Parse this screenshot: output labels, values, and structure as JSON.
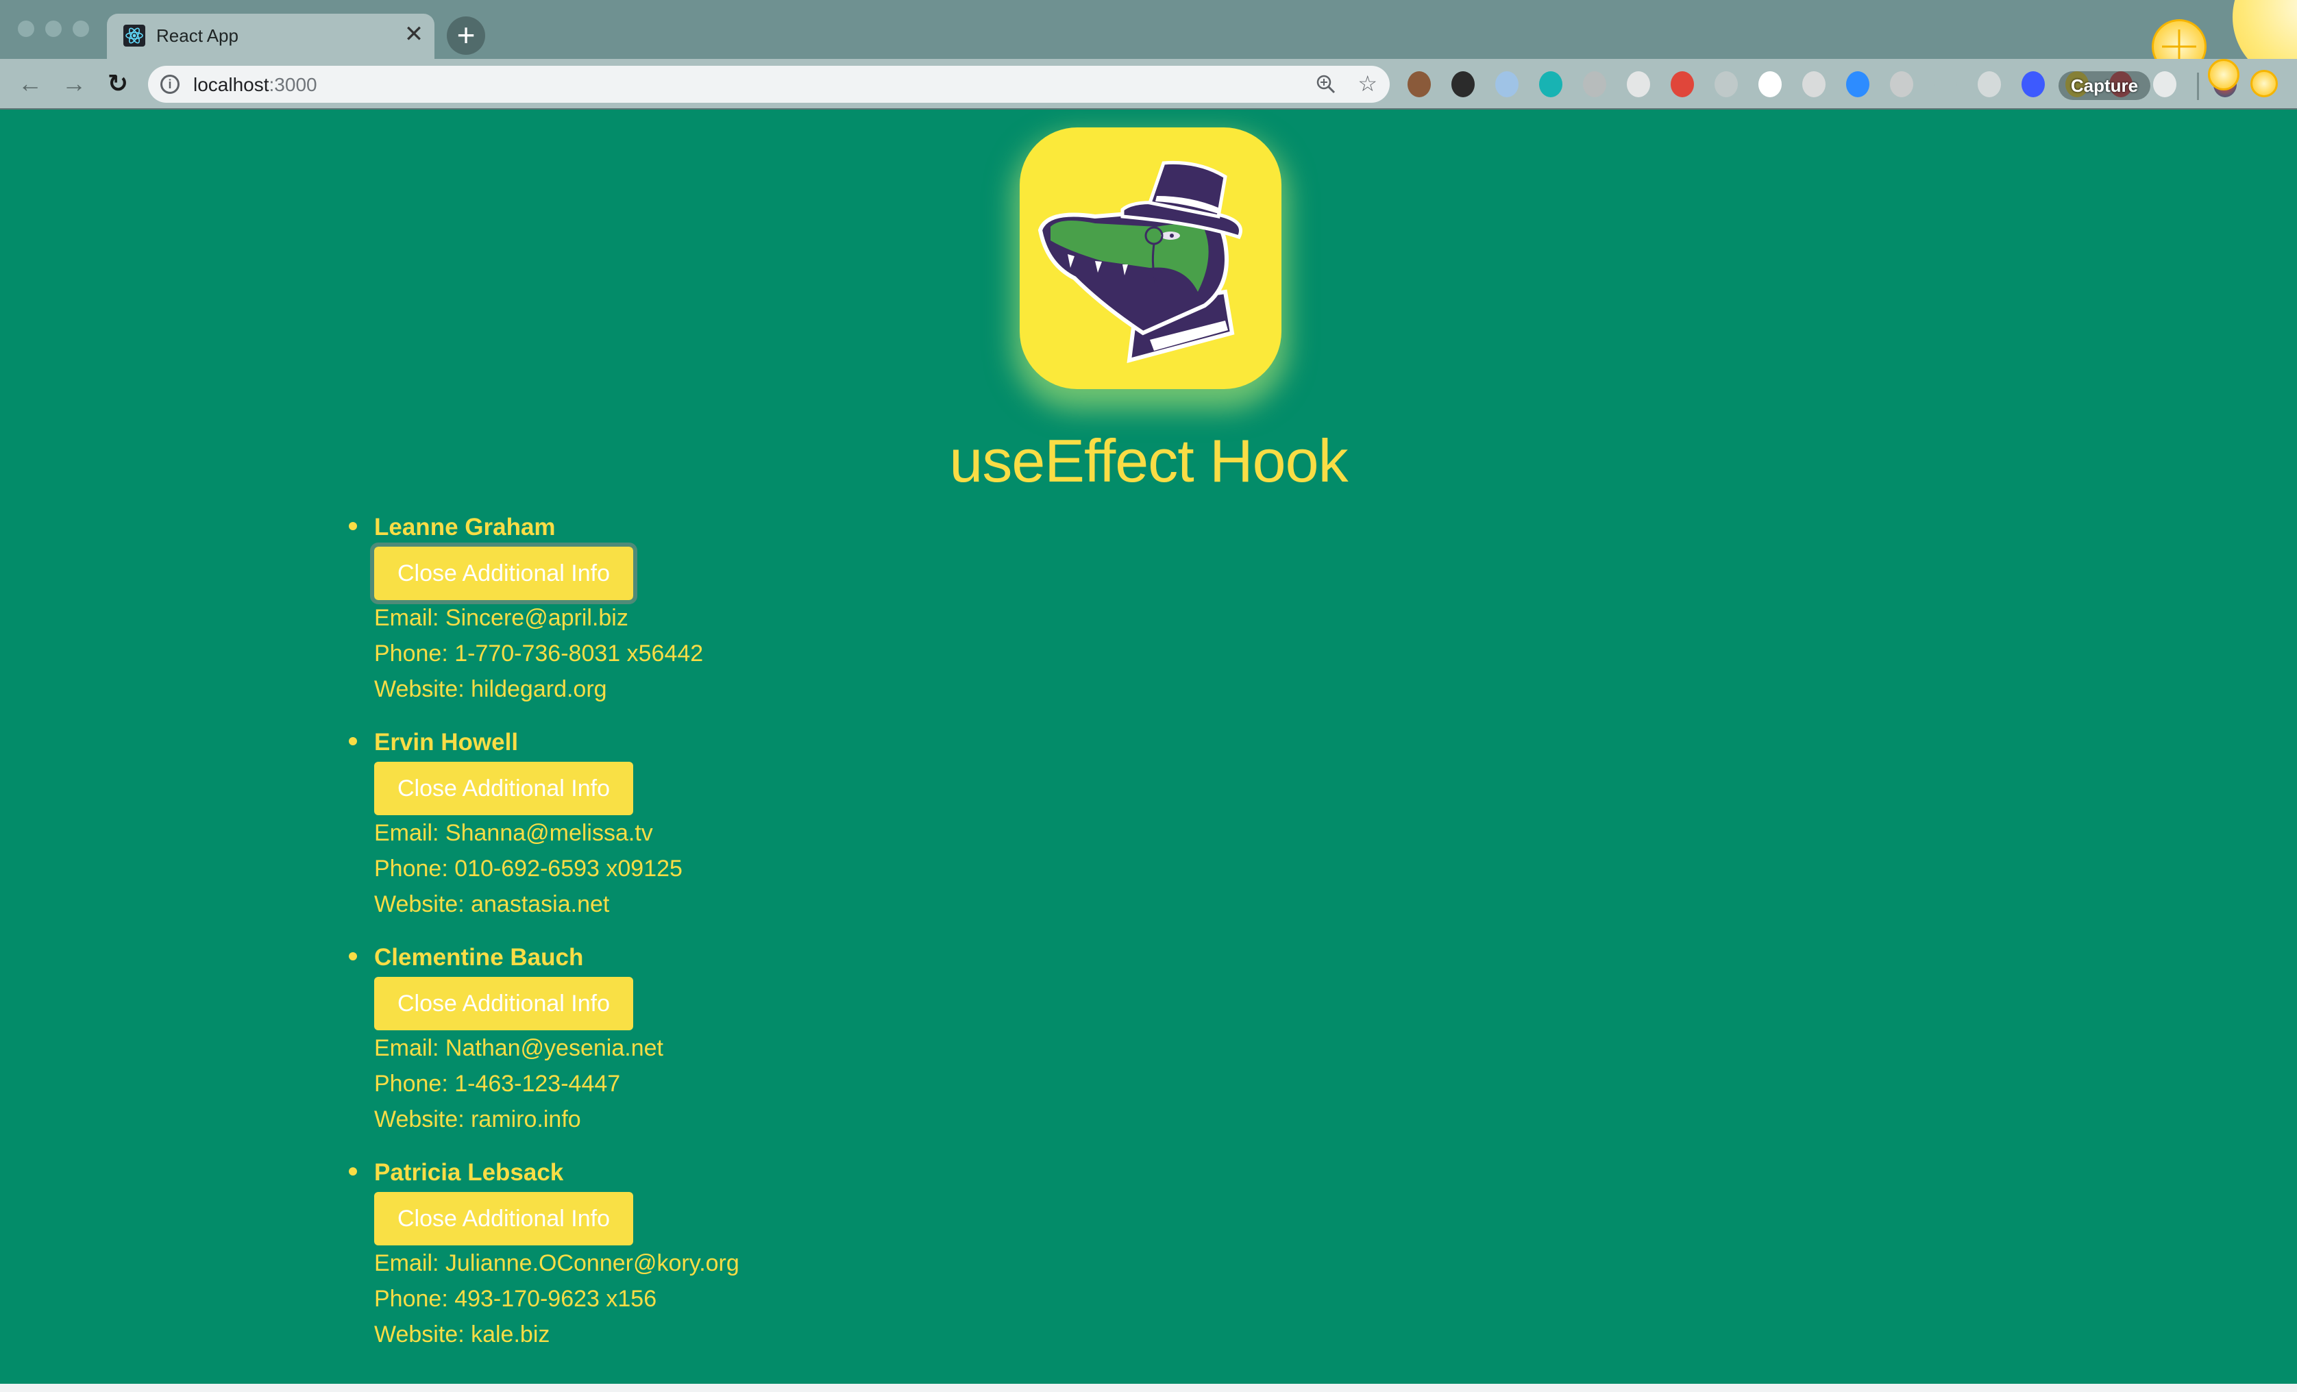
{
  "browser": {
    "tab": {
      "title": "React App",
      "favicon": "react-logo-icon",
      "close_glyph": "✕"
    },
    "new_tab_glyph": "+",
    "nav": {
      "back_glyph": "←",
      "forward_glyph": "→",
      "reload_glyph": "↻"
    },
    "address": {
      "host": "localhost",
      "port": ":3000"
    },
    "omnibox_icons": [
      "zoom-icon",
      "bookmark-star-icon"
    ],
    "extensions": [
      {
        "name": "cookie-extension-icon",
        "color": "#8a5a3a"
      },
      {
        "name": "green-battery-extension-icon",
        "color": "#2b2b2b"
      },
      {
        "name": "blue-swirl-extension-icon",
        "color": "#9fc3e6"
      },
      {
        "name": "teal-m-extension-icon",
        "color": "#18b3b3"
      },
      {
        "name": "command-key-extension-icon",
        "color": "#b7bcbc"
      },
      {
        "name": "moon-extension-icon",
        "color": "#e4e6e6"
      },
      {
        "name": "red-react-extension-icon",
        "color": "#e0463a"
      },
      {
        "name": "faded-extension-icon",
        "color": "#bfc9c9"
      },
      {
        "name": "eye-extension-icon",
        "color": "#ffffff"
      },
      {
        "name": "white-oval-extension-icon",
        "color": "#d9dbdb"
      },
      {
        "name": "zoom-video-extension-icon",
        "color": "#2d8cff"
      },
      {
        "name": "outlet-extension-icon",
        "color": "#c9cccc"
      },
      {
        "name": "plane-extension-icon",
        "color": "#abbfbf"
      },
      {
        "name": "circle-target-extension-icon",
        "color": "#d4dada"
      },
      {
        "name": "lighthouse-extension-icon",
        "color": "#3d5afe"
      },
      {
        "name": "yellow-square-extension-icon",
        "color": "#e6b800"
      },
      {
        "name": "red-power-extension-icon",
        "color": "#c8161d"
      },
      {
        "name": "ghost-face-extension-icon",
        "color": "#e7eaea"
      }
    ],
    "capture_label": "Capture",
    "profile_avatar": "profile-avatar"
  },
  "page": {
    "title": "useEffect Hook",
    "logo_alt": "alligator-with-top-hat-logo",
    "colors": {
      "background": "#038c69",
      "accent": "#f9dd45",
      "button_bg": "#f9e045",
      "button_text": "#ffffff"
    },
    "users": [
      {
        "name": "Leanne Graham",
        "button_label": "Close Additional Info",
        "email": "Email: Sincere@april.biz",
        "phone": "Phone: 1-770-736-8031 x56442",
        "website": "Website: hildegard.org",
        "focused": true
      },
      {
        "name": "Ervin Howell",
        "button_label": "Close Additional Info",
        "email": "Email: Shanna@melissa.tv",
        "phone": "Phone: 010-692-6593 x09125",
        "website": "Website: anastasia.net",
        "focused": false
      },
      {
        "name": "Clementine Bauch",
        "button_label": "Close Additional Info",
        "email": "Email: Nathan@yesenia.net",
        "phone": "Phone: 1-463-123-4447",
        "website": "Website: ramiro.info",
        "focused": false
      },
      {
        "name": "Patricia Lebsack",
        "button_label": "Close Additional Info",
        "email": "Email: Julianne.OConner@kory.org",
        "phone": "Phone: 493-170-9623 x156",
        "website": "Website: kale.biz",
        "focused": false
      }
    ]
  }
}
